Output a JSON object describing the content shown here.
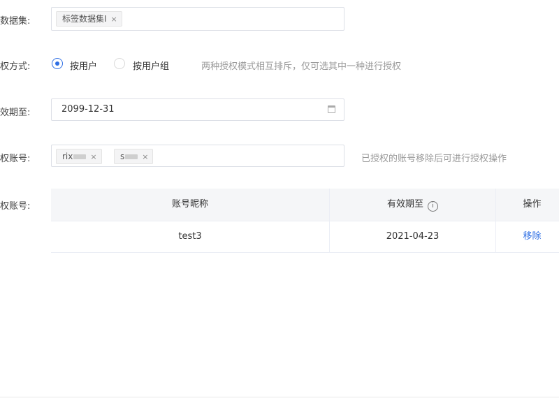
{
  "form": {
    "dataset_label": "数据集:",
    "dataset_tag": "标签数据集I",
    "auth_mode_label": "权方式:",
    "auth_mode_options": [
      "按用户",
      "按用户组"
    ],
    "auth_mode_hint": "两种授权模式相互排斥，仅可选其中一种进行授权",
    "expiry_label": "效期至:",
    "expiry_value": "2099-12-31",
    "accounts_label": "权账号:",
    "account_tags": [
      "rix",
      "s"
    ],
    "accounts_hint": "已授权的账号移除后可进行授权操作",
    "authorized_label": "权账号:"
  },
  "table": {
    "headers": [
      "账号昵称",
      "有效期至",
      "操作"
    ],
    "rows": [
      {
        "nickname": "test3",
        "expiry": "2021-04-23",
        "action": "移除"
      }
    ]
  },
  "icons": {
    "tag_close": "×",
    "info": "i"
  },
  "colors": {
    "accent": "#2f6fe4"
  }
}
